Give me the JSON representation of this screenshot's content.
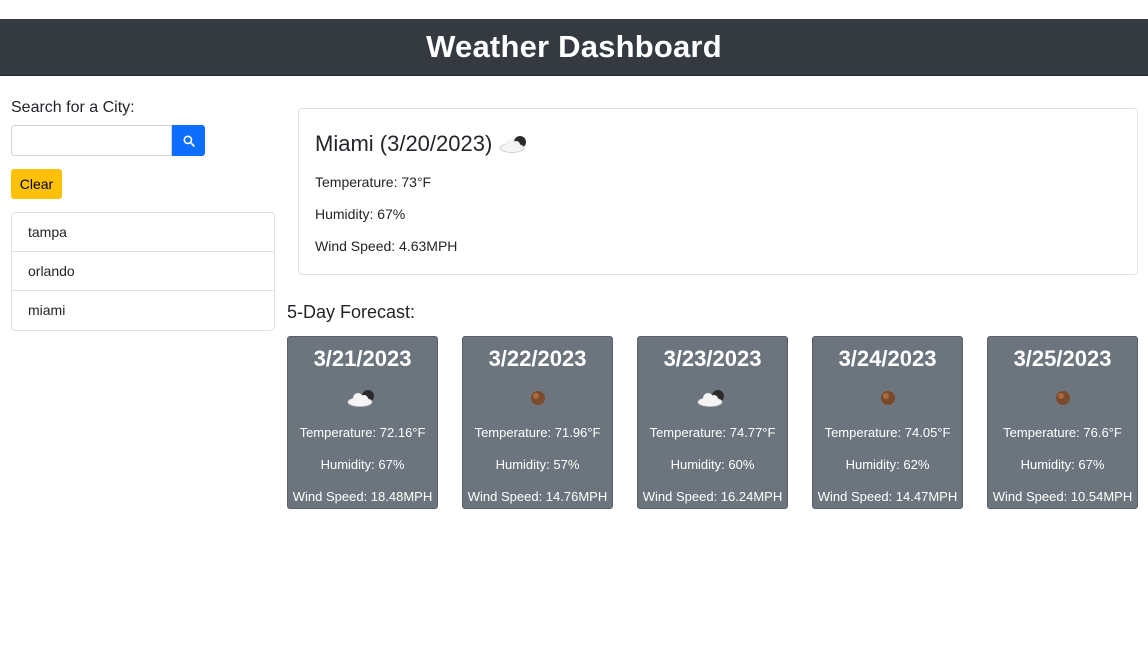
{
  "header": {
    "title": "Weather Dashboard"
  },
  "search": {
    "label": "Search for a City:",
    "placeholder": "",
    "value": "",
    "button_icon": "search-icon",
    "clear_label": "Clear"
  },
  "history": {
    "items": [
      "tampa",
      "orlando",
      "miami"
    ]
  },
  "current": {
    "title": "Miami (3/20/2023)",
    "icon": "cloud-icon",
    "temperature": "Temperature: 73°F",
    "humidity": "Humidity: 67%",
    "wind": "Wind Speed: 4.63MPH"
  },
  "forecast": {
    "heading": "5-Day Forecast:",
    "days": [
      {
        "date": "3/21/2023",
        "icon": "cloud-icon",
        "temperature": "Temperature: 72.16°F",
        "humidity": "Humidity: 67%",
        "wind": "Wind Speed: 18.48MPH"
      },
      {
        "date": "3/22/2023",
        "icon": "ball-icon",
        "temperature": "Temperature: 71.96°F",
        "humidity": "Humidity: 57%",
        "wind": "Wind Speed: 14.76MPH"
      },
      {
        "date": "3/23/2023",
        "icon": "cloud-icon",
        "temperature": "Temperature: 74.77°F",
        "humidity": "Humidity: 60%",
        "wind": "Wind Speed: 16.24MPH"
      },
      {
        "date": "3/24/2023",
        "icon": "ball-icon",
        "temperature": "Temperature: 74.05°F",
        "humidity": "Humidity: 62%",
        "wind": "Wind Speed: 14.47MPH"
      },
      {
        "date": "3/25/2023",
        "icon": "ball-icon",
        "temperature": "Temperature: 76.6°F",
        "humidity": "Humidity: 67%",
        "wind": "Wind Speed: 10.54MPH"
      }
    ]
  },
  "colors": {
    "header_bg": "#343a40",
    "search_button": "#0d6efd",
    "clear_button": "#ffc107",
    "forecast_card": "#6c757d"
  }
}
